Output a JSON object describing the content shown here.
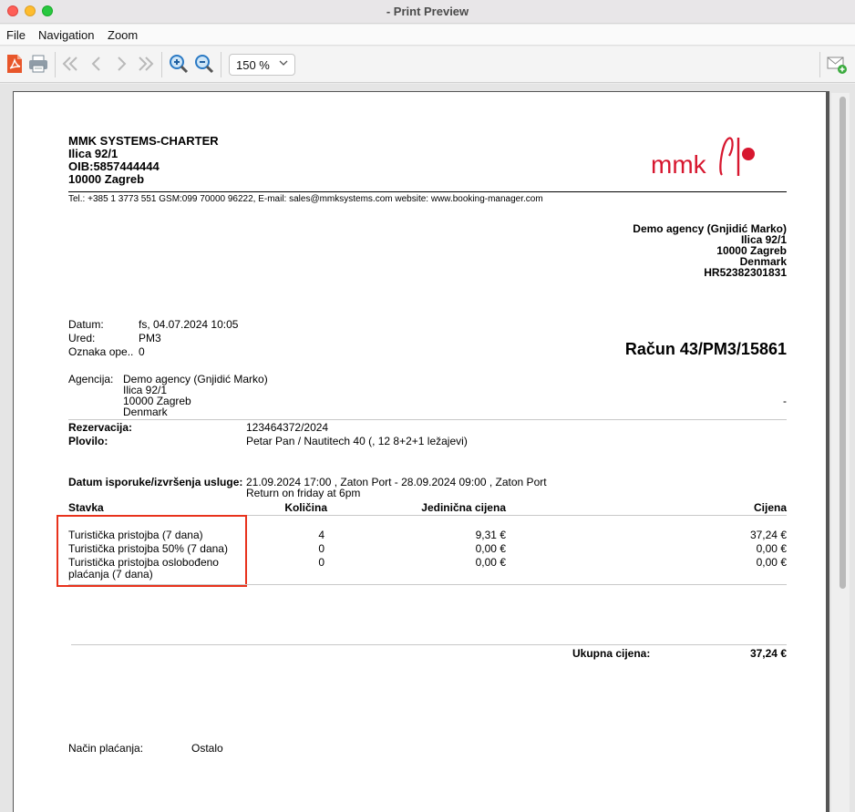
{
  "window": {
    "title": "- Print Preview"
  },
  "menu": {
    "file": "File",
    "navigation": "Navigation",
    "zoom": "Zoom"
  },
  "toolbar": {
    "zoom_value": "150 %",
    "icons": [
      "pdf-icon",
      "print-icon",
      "first-page-icon",
      "prev-page-icon",
      "next-page-icon",
      "last-page-icon",
      "zoom-in-icon",
      "zoom-out-icon",
      "email-add-icon"
    ]
  },
  "company": {
    "name": "MMK SYSTEMS-CHARTER",
    "street": "Ilica 92/1",
    "oib": "OIB:5857444444",
    "city": "10000 Zagreb",
    "contact_line": "Tel.: +385 1 3773 551 GSM:099 70000 96222, E-mail: sales@mmksystems.com website: www.booking-manager.com",
    "logo_text": "mmk",
    "logo_color": "#d7172f"
  },
  "recipient": {
    "name": "Demo agency (Gnjidić Marko)",
    "street": "Ilica 92/1",
    "city": "10000 Zagreb",
    "country": "Denmark",
    "vat": "HR52382301831"
  },
  "meta": {
    "datum_label": "Datum:",
    "datum_value": "fs, 04.07.2024 10:05",
    "ured_label": "Ured:",
    "ured_value": "PM3",
    "oznaka_label": "Oznaka ope..",
    "oznaka_value": "0",
    "invoice_title": "Račun  43/PM3/15861"
  },
  "agency": {
    "label": "Agencija:",
    "name": "Demo agency (Gnjidić Marko)",
    "street": "Ilica 92/1",
    "city": "10000 Zagreb",
    "country": "Denmark",
    "dash": "-"
  },
  "reservation": {
    "rez_label": "Rezervacija:",
    "rez_value": "123464372/2024",
    "plovilo_label": "Plovilo:",
    "plovilo_value": "Petar Pan / Nautitech 40 (, 12 8+2+1 ležajevi)",
    "service_label": "Datum isporuke/izvršenja usluge:",
    "service_value": "21.09.2024 17:00 , Zaton Port - 28.09.2024 09:00 , Zaton Port",
    "service_note": "Return on friday at 6pm"
  },
  "items_table": {
    "headers": {
      "stavka": "Stavka",
      "kolicina": "Količina",
      "jedinicna": "Jedinična cijena",
      "cijena": "Cijena"
    },
    "rows": [
      {
        "stavka": "Turistička pristojba (7 dana)",
        "stavka2": "",
        "kolicina": "4",
        "jedinicna": "9,31 €",
        "cijena": "37,24 €"
      },
      {
        "stavka": "Turistička pristojba 50% (7 dana)",
        "stavka2": "",
        "kolicina": "0",
        "jedinicna": "0,00 €",
        "cijena": "0,00 €"
      },
      {
        "stavka": "Turistička pristojba oslobođeno",
        "stavka2": "plaćanja (7 dana)",
        "kolicina": "0",
        "jedinicna": "0,00 €",
        "cijena": "0,00 €"
      }
    ]
  },
  "totals": {
    "label": "Ukupna cijena:",
    "value": "37,24 €"
  },
  "payment": {
    "label": "Način plaćanja:",
    "value": "Ostalo"
  }
}
